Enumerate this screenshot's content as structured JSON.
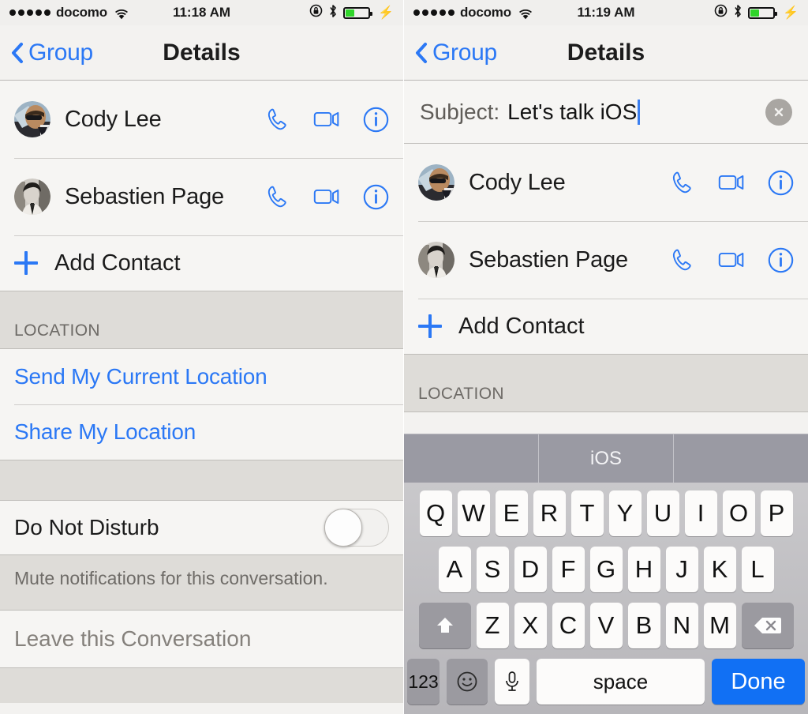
{
  "left": {
    "status": {
      "signal_dots": 5,
      "carrier": "docomo",
      "wifi_icon": "wifi-icon",
      "time": "11:18 AM",
      "rotation_lock_icon": "rotation-lock-icon",
      "bluetooth_icon": "bluetooth-icon",
      "battery_percent": 40,
      "battery_color": "#30d52a",
      "charging_icon": "lightning-bolt-icon"
    },
    "nav": {
      "back_label": "Group",
      "title": "Details",
      "tint": "#2b78f5"
    },
    "contacts": [
      {
        "name": "Cody Lee",
        "avatar": "color-photo"
      },
      {
        "name": "Sebastien Page",
        "avatar": "bw-photo"
      }
    ],
    "add_contact": "Add Contact",
    "location_header": "LOCATION",
    "location_links": [
      "Send My Current Location",
      "Share My Location"
    ],
    "do_not_disturb": {
      "label": "Do Not Disturb",
      "on": false
    },
    "footnote": "Mute notifications for this conversation.",
    "leave": "Leave this Conversation"
  },
  "right": {
    "status": {
      "signal_dots": 5,
      "carrier": "docomo",
      "wifi_icon": "wifi-icon",
      "time": "11:19 AM",
      "rotation_lock_icon": "rotation-lock-icon",
      "bluetooth_icon": "bluetooth-icon",
      "battery_percent": 40,
      "battery_color": "#30d52a",
      "charging_icon": "lightning-bolt-icon"
    },
    "nav": {
      "back_label": "Group",
      "title": "Details",
      "tint": "#2b78f5"
    },
    "subject": {
      "label": "Subject:",
      "value": "Let's talk iOS",
      "clear_icon": "clear-circle-icon"
    },
    "contacts": [
      {
        "name": "Cody Lee",
        "avatar": "color-photo"
      },
      {
        "name": "Sebastien Page",
        "avatar": "bw-photo"
      }
    ],
    "add_contact": "Add Contact",
    "location_header": "LOCATION",
    "keyboard": {
      "predictions": [
        "",
        "iOS",
        ""
      ],
      "row1": [
        "Q",
        "W",
        "E",
        "R",
        "T",
        "Y",
        "U",
        "I",
        "O",
        "P"
      ],
      "row2": [
        "A",
        "S",
        "D",
        "F",
        "G",
        "H",
        "J",
        "K",
        "L"
      ],
      "row3": [
        "Z",
        "X",
        "C",
        "V",
        "B",
        "N",
        "M"
      ],
      "shift_icon": "shift-arrow-icon",
      "backspace_icon": "backspace-icon",
      "numeric_label": "123",
      "emoji_icon": "smiley-icon",
      "mic_icon": "microphone-icon",
      "space_label": "space",
      "done_label": "Done",
      "done_color": "#1170f4"
    }
  },
  "icons": {
    "phone": "phone-icon",
    "video": "video-camera-icon",
    "info": "info-circle-icon",
    "plus": "plus-icon"
  }
}
